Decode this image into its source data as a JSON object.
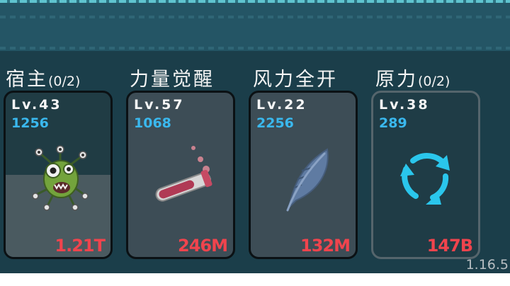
{
  "cards": [
    {
      "title": "宿主",
      "count": "(0/2)",
      "level": "Lv.43",
      "value": "1256",
      "cost": "1.21T",
      "icon": "alien-monster-icon"
    },
    {
      "title": "力量觉醒",
      "count": "",
      "level": "Lv.57",
      "value": "1068",
      "cost": "246M",
      "icon": "potion-test-tube-icon"
    },
    {
      "title": "风力全开",
      "count": "",
      "level": "Lv.22",
      "value": "2256",
      "cost": "132M",
      "icon": "feather-icon"
    },
    {
      "title": "原力",
      "count": "(0/2)",
      "level": "Lv.38",
      "value": "289",
      "cost": "147B",
      "icon": "refresh-cycle-icon"
    }
  ],
  "version": "1.16.5",
  "colors": {
    "level_text": "#f7f7f7",
    "value_text": "#3ab8ee",
    "cost_text": "#f0444d",
    "background": "#1b3e4a",
    "card": "#3d4d56"
  }
}
